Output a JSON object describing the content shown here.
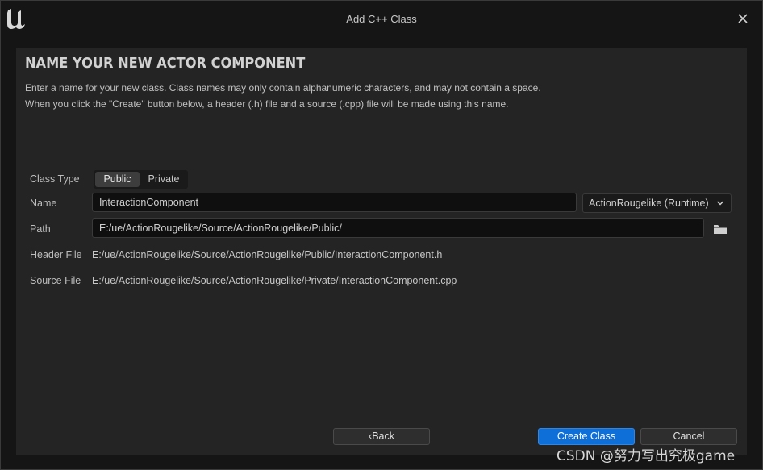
{
  "window": {
    "title": "Add C++ Class",
    "logo_icon": "unreal-engine-logo",
    "close_icon": "close-icon"
  },
  "header": {
    "heading": "NAME YOUR NEW ACTOR COMPONENT",
    "description_line1": "Enter a name for your new class. Class names may only contain alphanumeric characters, and may not contain a space.",
    "description_line2": "When you click the \"Create\" button below, a header (.h) file and a source (.cpp) file will be made using this name."
  },
  "form": {
    "class_type_label": "Class Type",
    "class_type_options": [
      "Public",
      "Private"
    ],
    "class_type_selected": "Public",
    "name_label": "Name",
    "name_value": "InteractionComponent",
    "module_select": "ActionRougelike (Runtime)",
    "path_label": "Path",
    "path_value": "E:/ue/ActionRougelike/Source/ActionRougelike/Public/",
    "header_file_label": "Header File",
    "header_file_value": "E:/ue/ActionRougelike/Source/ActionRougelike/Public/InteractionComponent.h",
    "source_file_label": "Source File",
    "source_file_value": "E:/ue/ActionRougelike/Source/ActionRougelike/Private/InteractionComponent.cpp"
  },
  "footer": {
    "back_label": "Back",
    "create_label": "Create Class",
    "cancel_label": "Cancel"
  },
  "watermark": "CSDN @努力写出究极game",
  "colors": {
    "primary_button": "#0e6fd8",
    "panel_bg": "#242424",
    "window_bg": "#151515"
  }
}
